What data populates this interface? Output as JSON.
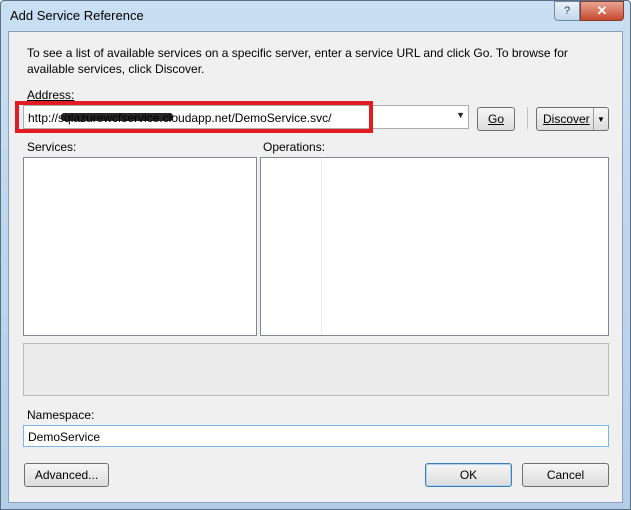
{
  "window": {
    "title": "Add Service Reference",
    "help_glyph": "?",
    "close_glyph": "✕"
  },
  "instructions": "To see a list of available services on a specific server, enter a service URL and click Go. To browse for available services, click Discover.",
  "address": {
    "label": "Address:",
    "value": "http://sqlazurewcfservice.cloudapp.net/DemoService.svc/",
    "dropdown_glyph": "▼",
    "go_label": "Go",
    "discover_label": "Discover",
    "discover_arrow": "▼"
  },
  "services": {
    "label": "Services:",
    "items": []
  },
  "operations": {
    "label": "Operations:",
    "items": []
  },
  "namespace": {
    "label": "Namespace:",
    "value": "DemoService"
  },
  "buttons": {
    "advanced": "Advanced...",
    "ok": "OK",
    "cancel": "Cancel"
  },
  "colors": {
    "highlight": "#e31b23",
    "titlebar": "#c9dff3"
  }
}
